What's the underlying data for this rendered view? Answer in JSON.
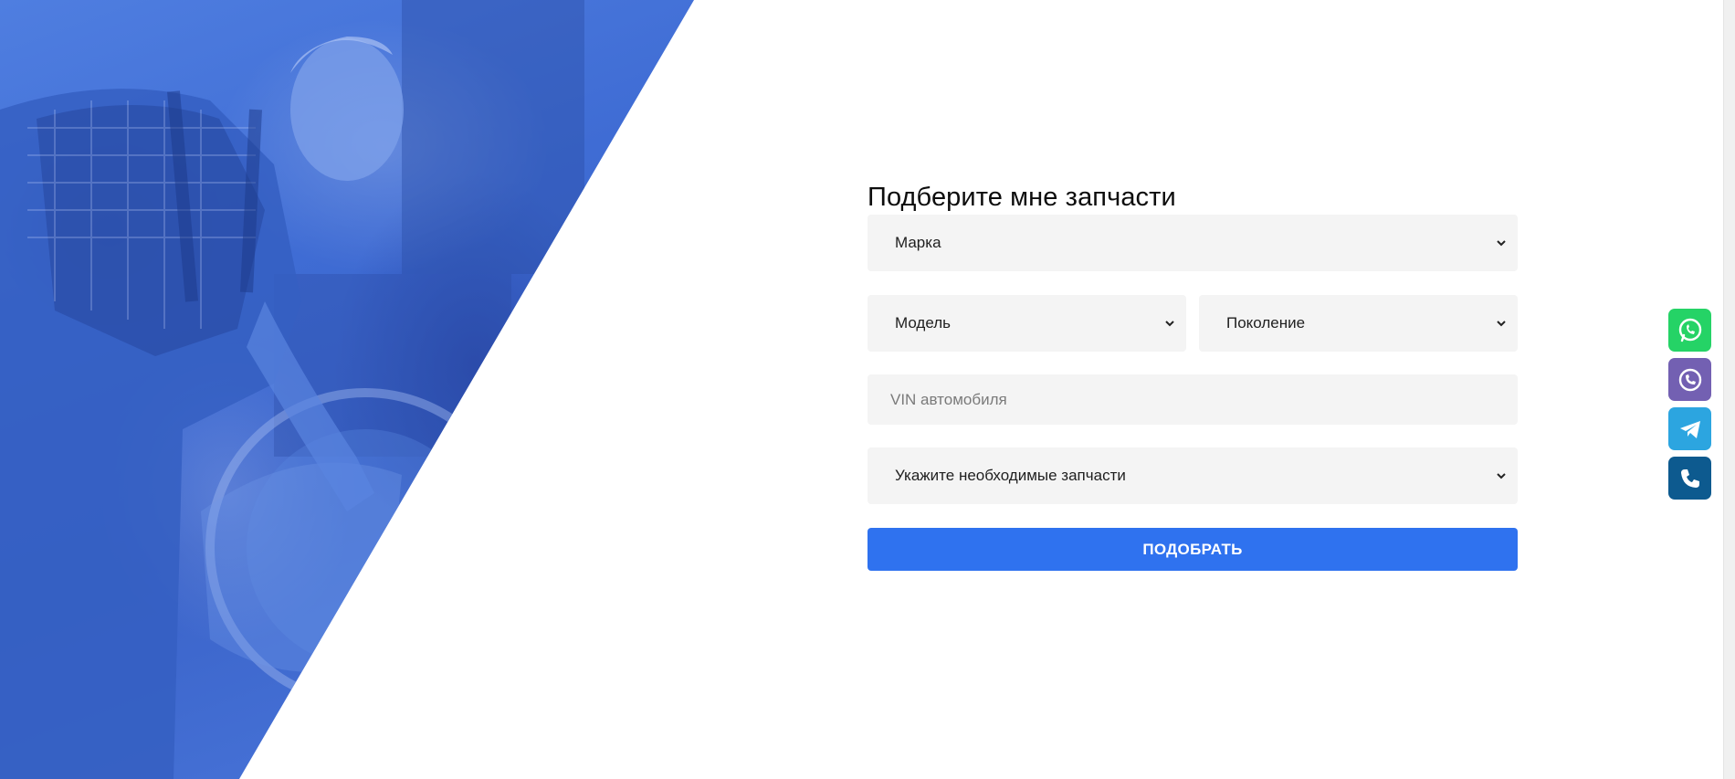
{
  "form": {
    "title": "Подберите мне запчасти",
    "brand_select": "Марка",
    "model_select": "Модель",
    "generation_select": "Поколение",
    "vin_placeholder": "VIN автомобиля",
    "parts_select": "Укажите необходимые запчасти",
    "submit_label": "ПОДОБРАТЬ"
  },
  "messengers": [
    {
      "name": "whatsapp",
      "icon": "whatsapp-icon",
      "color": "#25d366"
    },
    {
      "name": "viber",
      "icon": "viber-icon",
      "color": "#7360b2"
    },
    {
      "name": "telegram",
      "icon": "telegram-icon",
      "color": "#2ca5e0"
    },
    {
      "name": "phone",
      "icon": "phone-icon",
      "color": "#0d5a8f"
    }
  ],
  "colors": {
    "accent": "#2f72ef",
    "hero_blue": "#3f6cd4",
    "field_bg": "#f4f4f4"
  }
}
